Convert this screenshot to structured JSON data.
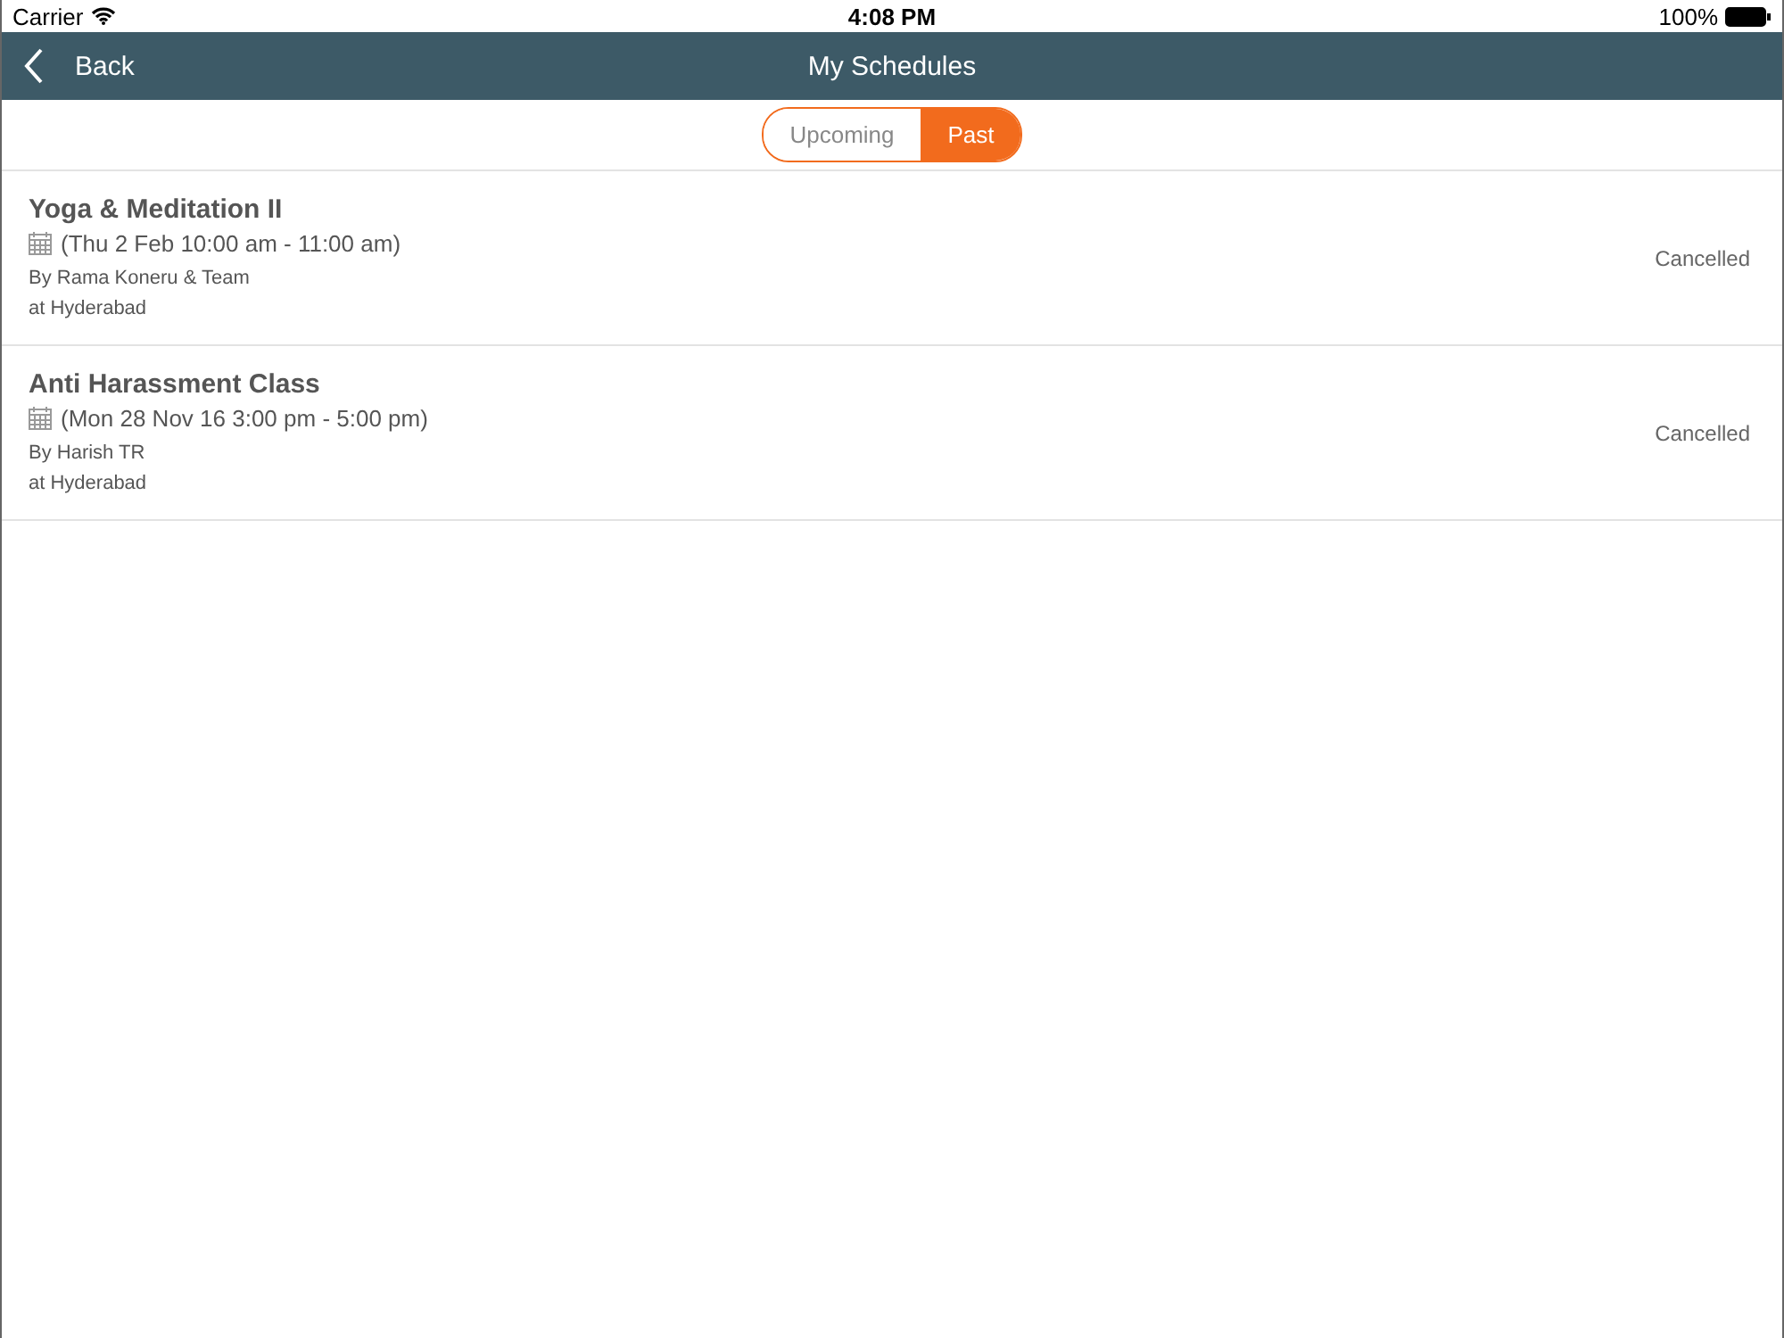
{
  "status_bar": {
    "carrier": "Carrier",
    "time": "4:08 PM",
    "battery": "100%"
  },
  "nav_bar": {
    "back": "Back",
    "title": "My Schedules"
  },
  "segments": [
    {
      "label": "Upcoming",
      "selected": false
    },
    {
      "label": "Past",
      "selected": true
    }
  ],
  "schedules": [
    {
      "title": "Yoga & Meditation II",
      "when": "(Thu 2 Feb 10:00 am - 11:00 am)",
      "by": "By Rama Koneru & Team",
      "where": "at Hyderabad",
      "status": "Cancelled"
    },
    {
      "title": "Anti Harassment Class",
      "when": "(Mon 28 Nov 16 3:00 pm - 5:00 pm)",
      "by": "By Harish TR",
      "where": "at Hyderabad",
      "status": "Cancelled"
    }
  ]
}
